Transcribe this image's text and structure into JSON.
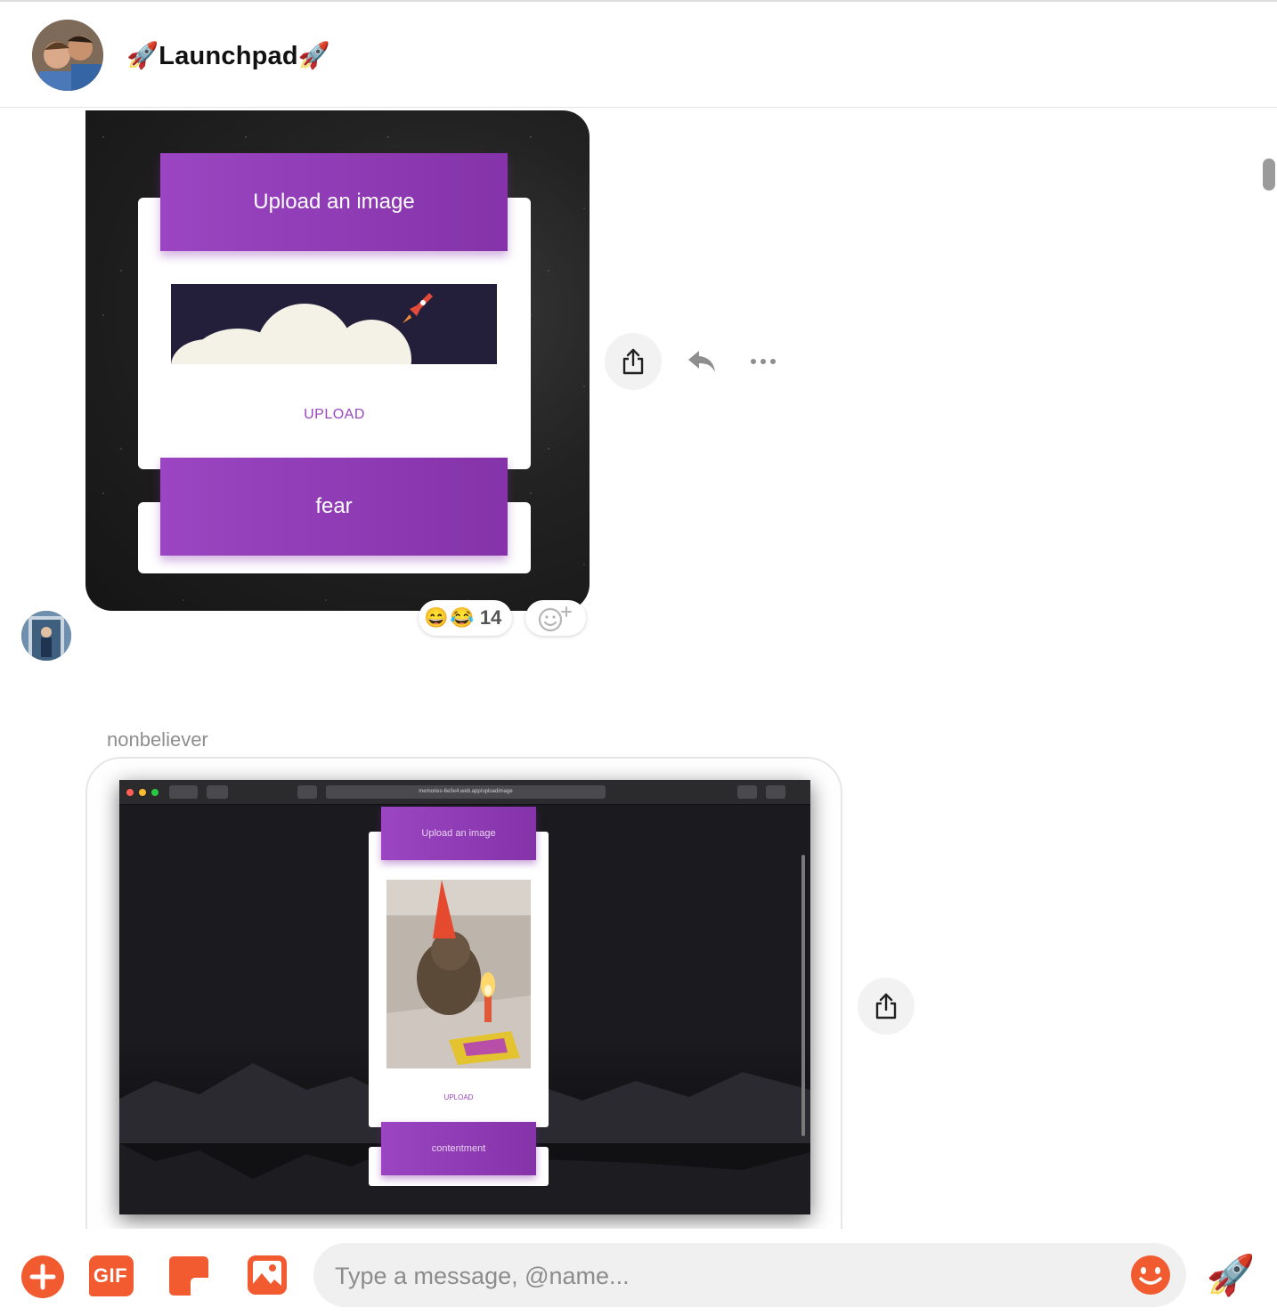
{
  "header": {
    "title": "🚀Launchpad🚀"
  },
  "message1": {
    "image": {
      "heading": "Upload an image",
      "upload_label": "UPLOAD",
      "emotion": "fear"
    },
    "reactions": {
      "emojis": [
        "😄",
        "😂"
      ],
      "count": "14"
    }
  },
  "message2": {
    "sender": "nonbeliever",
    "image": {
      "url": "memories-6e3e4.web.app/uploadimage",
      "heading": "Upload an image",
      "upload_label": "UPLOAD",
      "emotion": "contentment"
    }
  },
  "composer": {
    "placeholder": "Type a message, @name...",
    "gif_label": "GIF",
    "send_emoji": "🚀"
  },
  "colors": {
    "accent": "#f25a30",
    "purple": "#9b45c2"
  }
}
